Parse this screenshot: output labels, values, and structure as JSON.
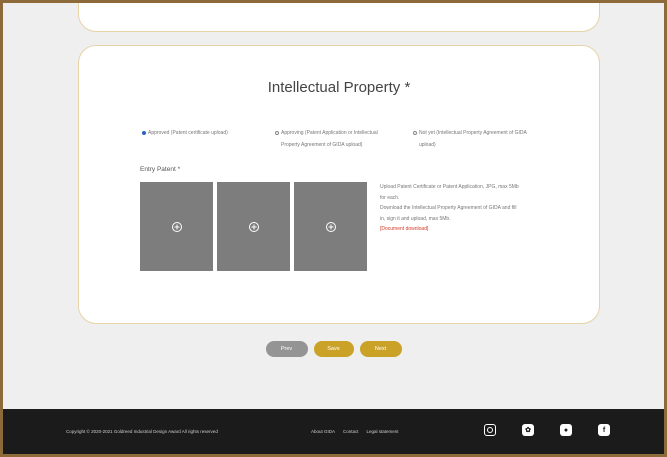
{
  "form": {
    "title": "Intellectual Property *",
    "options": [
      "Approved (Patent certificate upload)",
      "Approving (Patent Application or Intellectual Property Agreement of GIDA upload)",
      "Not yet (Intellectual Property Agreement of GIDA upload)"
    ],
    "entry_label": "Entry Patent *",
    "help_line1": "Upload Patent Certificate or Patent Application, JPG, max 5Mb for each.",
    "help_line2": "Download the Intellectual Property Agreement of GIDA and fill in, sign it and upload, max 5Mb.",
    "document_link": "[Document download]"
  },
  "buttons": {
    "prev": "Prev",
    "save": "Save",
    "next": "Next"
  },
  "footer": {
    "copyright": "Copyright © 2020-2021 Goldreed Industrial Design Award All rights reserved",
    "links": [
      "About GIDA",
      "Contact",
      "Legal statement"
    ]
  },
  "socials": [
    "instagram-icon",
    "wechat-icon",
    "weibo-icon",
    "facebook-icon"
  ]
}
